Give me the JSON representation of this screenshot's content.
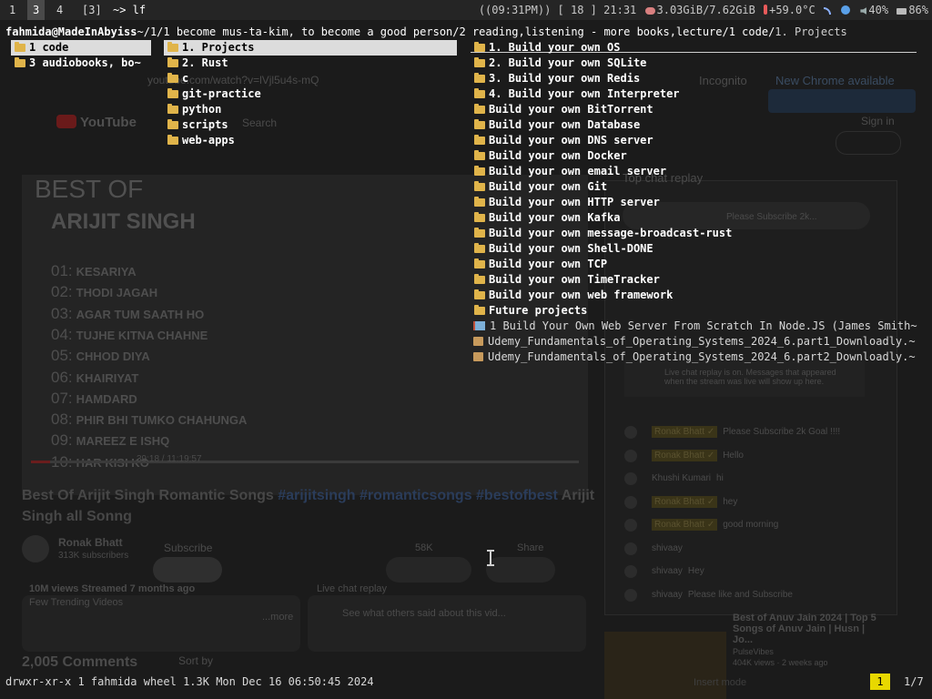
{
  "tmux": {
    "windows": [
      "1",
      "3",
      "4",
      "[3]"
    ],
    "active_index": 1,
    "command": "~> lf",
    "status": {
      "time_label": "((09:31PM))",
      "day": "[ 18 ]",
      "clock": "21:31",
      "memory": "3.03GiB/7.62GiB",
      "temperature": "+59.0°C",
      "volume": "40%",
      "battery": "86%"
    }
  },
  "lf": {
    "user_host": "fahmida@MadeInAbyiss",
    "path": "~/1/1 become mus-ta-kim, to become a good person/2 reading,listening - more books,lecture/1 code/",
    "current_file": "1. Projects",
    "parent_column": [
      {
        "name": "1 code",
        "type": "dir",
        "selected": true
      },
      {
        "name": "3 audiobooks, bo~",
        "type": "dir",
        "selected": false
      }
    ],
    "current_column": [
      {
        "name": "1. Projects",
        "type": "dir",
        "selected": true
      },
      {
        "name": "2. Rust",
        "type": "dir"
      },
      {
        "name": "c",
        "type": "dir"
      },
      {
        "name": "git-practice",
        "type": "dir"
      },
      {
        "name": "python",
        "type": "dir"
      },
      {
        "name": "scripts",
        "type": "dir"
      },
      {
        "name": "web-apps",
        "type": "dir"
      }
    ],
    "preview_column": [
      {
        "name": "1. Build your own OS",
        "type": "dir"
      },
      {
        "name": "2. Build your own SQLite",
        "type": "dir"
      },
      {
        "name": "3. Build your own Redis",
        "type": "dir"
      },
      {
        "name": "4. Build your own Interpreter",
        "type": "dir"
      },
      {
        "name": "Build your own BitTorrent",
        "type": "dir"
      },
      {
        "name": "Build your own Database",
        "type": "dir"
      },
      {
        "name": "Build your own DNS server",
        "type": "dir"
      },
      {
        "name": "Build your own Docker",
        "type": "dir"
      },
      {
        "name": "Build your own email server",
        "type": "dir"
      },
      {
        "name": "Build your own Git",
        "type": "dir"
      },
      {
        "name": "Build your own HTTP server",
        "type": "dir"
      },
      {
        "name": "Build your own Kafka",
        "type": "dir"
      },
      {
        "name": "Build your own message-broadcast-rust",
        "type": "dir"
      },
      {
        "name": "Build your own Shell-DONE",
        "type": "dir"
      },
      {
        "name": "Build your own TCP",
        "type": "dir"
      },
      {
        "name": "Build your own TimeTracker",
        "type": "dir"
      },
      {
        "name": "Build your own web framework",
        "type": "dir"
      },
      {
        "name": "Future projects",
        "type": "dir"
      },
      {
        "name": "1 Build Your Own Web Server From Scratch In Node.JS (James Smith~",
        "type": "book"
      },
      {
        "name": "Udemy_Fundamentals_of_Operating_Systems_2024_6.part1_Downloadly.~",
        "type": "archive"
      },
      {
        "name": "Udemy_Fundamentals_of_Operating_Systems_2024_6.part2_Downloadly.~",
        "type": "archive"
      }
    ],
    "file_info": "drwxr-xr-x 1 fahmida wheel 1.3K Mon Dec 16 06:50:45 2024",
    "position_index": "1",
    "position_count": "1/7"
  },
  "background_browser": {
    "url": "youtube.com/watch?v=lVjl5u4s-mQ",
    "incognito": "Incognito",
    "new_chrome": "New Chrome available",
    "search_placeholder": "Search",
    "sign_in": "Sign in",
    "video_overlay_title_1": "BEST OF",
    "video_overlay_title_2": "ARIJIT SINGH",
    "songs": [
      {
        "num": "01:",
        "title": "KESARIYA"
      },
      {
        "num": "02:",
        "title": "THODI JAGAH"
      },
      {
        "num": "03:",
        "title": "AGAR TUM SAATH HO"
      },
      {
        "num": "04:",
        "title": "TUJHE KITNA CHAHNE"
      },
      {
        "num": "05:",
        "title": "CHHOD DIYA"
      },
      {
        "num": "06:",
        "title": "KHAIRIYAT"
      },
      {
        "num": "07:",
        "title": "HAMDARD"
      },
      {
        "num": "08:",
        "title": "PHIR BHI TUMKO CHAHUNGA"
      },
      {
        "num": "09:",
        "title": "MAREEZ E ISHQ"
      },
      {
        "num": "10:",
        "title": "HAR KISI KO"
      }
    ],
    "playback_time": "39:18 / 11:19:57",
    "playback_progress": 0.035,
    "video_title": "Best Of Arijit Singh Romantic Songs #arijitsingh #romanticsongs #bestofbest Arijit Singh all Sonng",
    "channel": "Ronak Bhatt",
    "subscribers": "313K subscribers",
    "subscribe": "Subscribe",
    "likes": "58K",
    "share": "Share",
    "views": "10M views  Streamed 7 months ago",
    "desc_line": "Few Trending Videos",
    "desc_more": "...more",
    "live_replay_title": "Live chat replay",
    "live_replay_desc": "See what others said about this vid...",
    "comments": "2,005 Comments",
    "sort_by": "Sort by",
    "chat_header": "Top chat replay",
    "chat_pinned": "Please Subscribe 2k...",
    "chat_notice": "Live chat replay is on. Messages that appeared when the stream was live will show up here.",
    "chat_messages": [
      {
        "author": "Ronak Bhatt ✓",
        "text": "Please Subscribe 2k Goal !!!!"
      },
      {
        "author": "Ronak Bhatt ✓",
        "text": "Hello"
      },
      {
        "author": "Khushi Kumari",
        "text": "hi"
      },
      {
        "author": "Ronak Bhatt ✓",
        "text": "hey"
      },
      {
        "author": "Ronak Bhatt ✓",
        "text": "good morning"
      },
      {
        "author": "shivaay",
        "text": ""
      },
      {
        "author": "shivaay",
        "text": "Hey"
      },
      {
        "author": "shivaay",
        "text": "Please like and Subscribe"
      }
    ],
    "reco_title": "Best of Anuv Jain 2024 | Top 5 Songs of Anuv Jain | Husn | Jo...",
    "reco_channel": "PulseVibes",
    "reco_meta": "404K views · 2 weeks ago",
    "insert_mode": "Insert mode"
  }
}
